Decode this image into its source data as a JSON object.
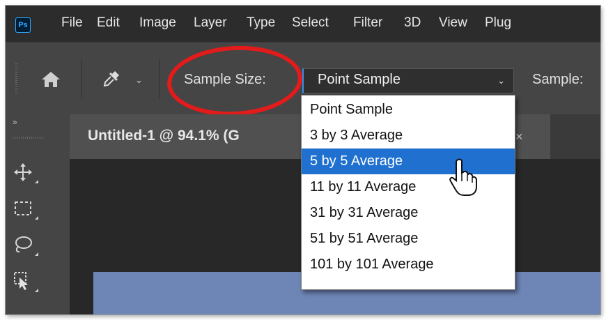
{
  "app": {
    "logo": "Ps"
  },
  "menu": [
    "File",
    "Edit",
    "Image",
    "Layer",
    "Type",
    "Select",
    "Filter",
    "3D",
    "View",
    "Plug"
  ],
  "options_bar": {
    "sample_size_label": "Sample Size:",
    "sample_size_value": "Point Sample",
    "sample_label": "Sample:"
  },
  "document": {
    "tab_title": "Untitled-1 @ 94.1% (G",
    "close_glyph": "×"
  },
  "toolbar": {
    "collapse_glyph": "»"
  },
  "dropdown": {
    "options": [
      "Point Sample",
      "3 by 3 Average",
      "5 by 5 Average",
      "11 by 11 Average",
      "31 by 31 Average",
      "51 by 51 Average",
      "101 by 101 Average"
    ],
    "highlighted": "5 by 5 Average"
  },
  "colors": {
    "accent_selection": "#1f70cf",
    "annotation_circle": "#e31b1b",
    "canvas_fill": "#6e86b6"
  }
}
